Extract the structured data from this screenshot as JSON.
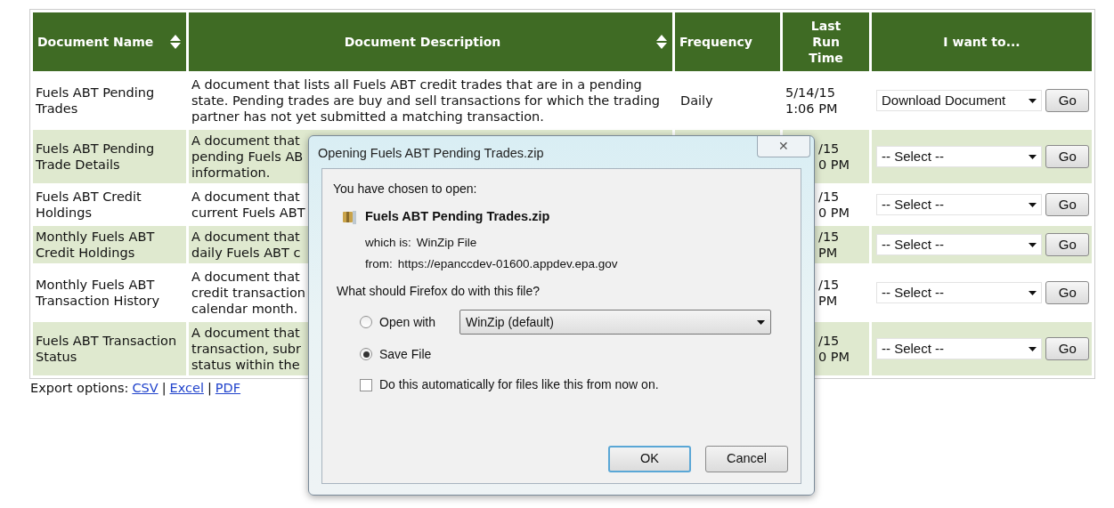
{
  "table": {
    "columns": [
      {
        "label": "Document Name",
        "sortable": true
      },
      {
        "label": "Document Description",
        "sortable": true
      },
      {
        "label": "Frequency",
        "sortable": false
      },
      {
        "label": "Last Run Time",
        "sortable": false
      },
      {
        "label": "I want to...",
        "sortable": false
      }
    ],
    "rows": [
      {
        "name": "Fuels ABT Pending Trades",
        "description": [
          "A document that lists all Fuels ABT credit trades that are in a pending state. Pending trades are buy and sell transactions for which the trading partner has not yet submitted a matching transaction."
        ],
        "frequency": "Daily",
        "last_run": [
          "5/14/15 1:06 PM"
        ],
        "partial": false,
        "action": "Download Document",
        "go": "Go"
      },
      {
        "name": "Fuels ABT Pending Trade Details",
        "description": [
          "A document that",
          "pending Fuels AB",
          "information."
        ],
        "last_run": [
          "/15",
          "0 PM"
        ],
        "partial": true,
        "action": "-- Select --",
        "go": "Go"
      },
      {
        "name": "Fuels ABT Credit Holdings",
        "description": [
          "A document that",
          "current Fuels ABT"
        ],
        "last_run": [
          "/15",
          "0 PM"
        ],
        "partial": true,
        "action": "-- Select --",
        "go": "Go"
      },
      {
        "name": "Monthly Fuels ABT Credit Holdings",
        "description": [
          "A document that",
          "daily Fuels ABT c"
        ],
        "last_run": [
          "/15",
          "PM"
        ],
        "partial": true,
        "action": "-- Select --",
        "go": "Go"
      },
      {
        "name": "Monthly Fuels ABT Transaction History",
        "description": [
          "A document that",
          "credit transaction",
          "calendar month."
        ],
        "last_run": [
          "/15",
          "PM"
        ],
        "partial": true,
        "action": "-- Select --",
        "go": "Go"
      },
      {
        "name": "Fuels ABT Transaction Status",
        "description": [
          "A document that",
          "transaction, subr",
          "status within the"
        ],
        "last_run": [
          "/15",
          "0 PM"
        ],
        "partial": true,
        "action": "-- Select --",
        "go": "Go"
      }
    ]
  },
  "export": {
    "label": "Export options:",
    "links": [
      "CSV",
      "Excel",
      "PDF"
    ],
    "separator": "|"
  },
  "dialog": {
    "title": "Opening Fuels ABT Pending Trades.zip",
    "close": "✕",
    "intro": "You have chosen to open:",
    "file_name": "Fuels ABT Pending Trades.zip",
    "which_label": "which is:",
    "which_value": "WinZip File",
    "from_label": "from:",
    "from_value": "https://epanccdev-01600.appdev.epa.gov",
    "question": "What should Firefox do with this file?",
    "options": [
      {
        "label": "Open with",
        "selected": false,
        "app": "WinZip (default)"
      },
      {
        "label": "Save File",
        "selected": true
      }
    ],
    "auto": {
      "label": "Do this automatically for files like this from now on.",
      "checked": false
    },
    "buttons": [
      {
        "label": "OK",
        "default": true
      },
      {
        "label": "Cancel",
        "default": false
      }
    ]
  }
}
